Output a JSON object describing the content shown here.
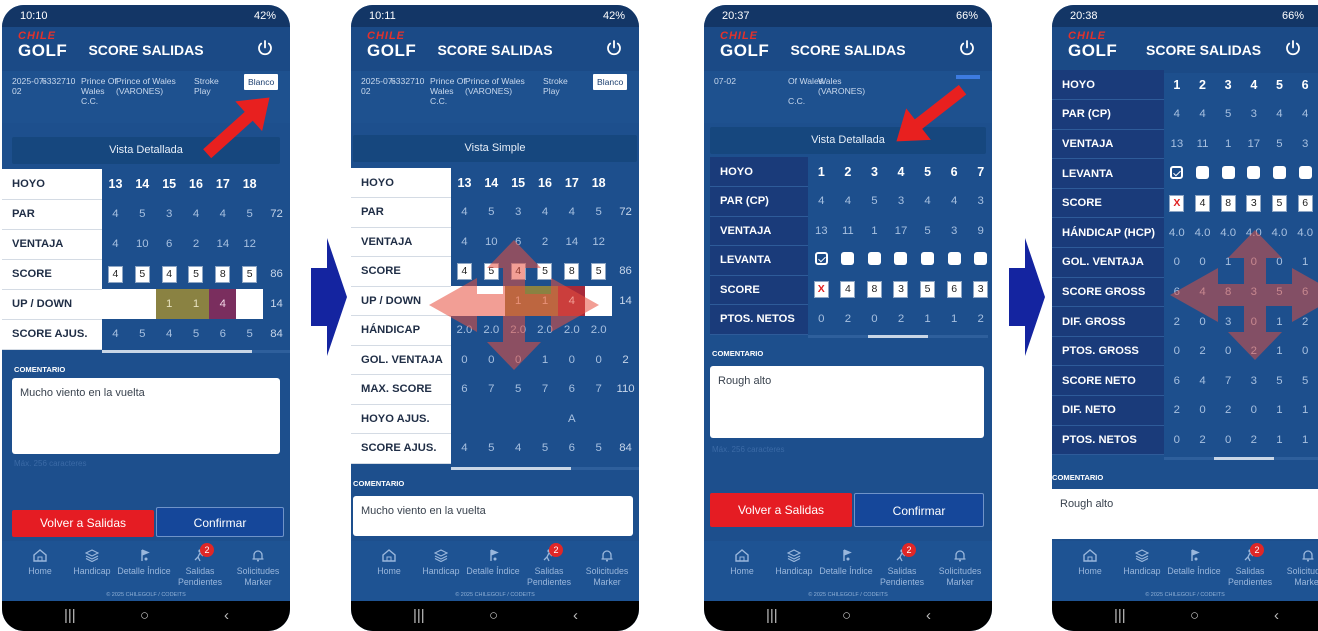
{
  "screens": [
    {
      "status": {
        "time": "10:10",
        "battery": "42%"
      },
      "title": "SCORE SALIDAS",
      "logo": {
        "line1": "CHILE",
        "line2": "GOLF"
      },
      "info": {
        "date": "2025-07-02",
        "id": "6332710",
        "club": "Prince Of Wales C.C.",
        "tee_course": "Prince of Wales (VARONES)",
        "mode": "Stroke Play",
        "tee": "Blanco"
      },
      "vista_button": "Vista Detallada",
      "rows": [
        {
          "label": "HOYO",
          "cells": [
            "13",
            "14",
            "15",
            "16",
            "17",
            "18"
          ],
          "total": ""
        },
        {
          "label": "PAR",
          "cells": [
            "4",
            "5",
            "3",
            "4",
            "4",
            "5"
          ],
          "total": "72"
        },
        {
          "label": "VENTAJA",
          "cells": [
            "4",
            "10",
            "6",
            "2",
            "14",
            "12"
          ],
          "total": ""
        },
        {
          "label": "SCORE",
          "cells": [
            "4",
            "5",
            "4",
            "5",
            "8",
            "5"
          ],
          "total": "86"
        },
        {
          "label": "UP / DOWN",
          "cells": [
            "",
            "",
            "1",
            "1",
            "4",
            ""
          ],
          "total": "14"
        },
        {
          "label": "SCORE AJUS.",
          "cells": [
            "4",
            "5",
            "4",
            "5",
            "6",
            "5"
          ],
          "total": "84"
        }
      ],
      "comment_label": "COMENTARIO",
      "comment": "Mucho viento en la vuelta",
      "max_chars": "Máx. 256 caracteres",
      "btn_back": "Volver a Salidas",
      "btn_confirm": "Confirmar"
    },
    {
      "status": {
        "time": "10:11",
        "battery": "42%"
      },
      "title": "SCORE SALIDAS",
      "logo": {
        "line1": "CHILE",
        "line2": "GOLF"
      },
      "info": {
        "date": "2025-07-02",
        "id": "6332710",
        "club": "Prince Of Wales C.C.",
        "tee_course": "Prince of Wales (VARONES)",
        "mode": "Stroke Play",
        "tee": "Blanco"
      },
      "vista_button": "Vista Simple",
      "rows": [
        {
          "label": "HOYO",
          "cells": [
            "13",
            "14",
            "15",
            "16",
            "17",
            "18"
          ],
          "total": ""
        },
        {
          "label": "PAR",
          "cells": [
            "4",
            "5",
            "3",
            "4",
            "4",
            "5"
          ],
          "total": "72"
        },
        {
          "label": "VENTAJA",
          "cells": [
            "4",
            "10",
            "6",
            "2",
            "14",
            "12"
          ],
          "total": ""
        },
        {
          "label": "SCORE",
          "cells": [
            "4",
            "5",
            "4",
            "5",
            "8",
            "5"
          ],
          "total": "86"
        },
        {
          "label": "UP / DOWN",
          "cells": [
            "",
            "",
            "1",
            "1",
            "4",
            ""
          ],
          "total": "14"
        },
        {
          "label": "HÁNDICAP",
          "cells": [
            "2.0",
            "2.0",
            "2.0",
            "2.0",
            "2.0",
            "2.0"
          ],
          "total": ""
        },
        {
          "label": "GOL. VENTAJA",
          "cells": [
            "0",
            "0",
            "0",
            "1",
            "0",
            "0"
          ],
          "total": "2"
        },
        {
          "label": "MAX. SCORE",
          "cells": [
            "6",
            "7",
            "5",
            "7",
            "6",
            "7"
          ],
          "total": "110"
        },
        {
          "label": "HOYO AJUS.",
          "cells": [
            "",
            "",
            "",
            "",
            "A",
            ""
          ],
          "total": ""
        },
        {
          "label": "SCORE AJUS.",
          "cells": [
            "4",
            "5",
            "4",
            "5",
            "6",
            "5"
          ],
          "total": "84"
        }
      ],
      "comment_label": "COMENTARIO",
      "comment": "Mucho viento en la vuelta"
    },
    {
      "status": {
        "time": "20:37",
        "battery": "66%"
      },
      "title": "SCORE SALIDAS",
      "logo": {
        "line1": "CHILE",
        "line2": "GOLF"
      },
      "info": {
        "date": "07-02",
        "club": "C.C.",
        "tee_course": "Wales (VARONES)",
        "club_line": "Of Wales"
      },
      "vista_button": "Vista Detallada",
      "rows": [
        {
          "label": "HOYO",
          "cells": [
            "1",
            "2",
            "3",
            "4",
            "5",
            "6",
            "7"
          ]
        },
        {
          "label": "PAR (CP)",
          "cells": [
            "4",
            "4",
            "5",
            "3",
            "4",
            "4",
            "3"
          ]
        },
        {
          "label": "VENTAJA",
          "cells": [
            "13",
            "11",
            "1",
            "17",
            "5",
            "3",
            "9"
          ]
        },
        {
          "label": "LEVANTA",
          "cells": [
            "on",
            "",
            "",
            "",
            "",
            "",
            ""
          ]
        },
        {
          "label": "SCORE",
          "cells": [
            "X",
            "4",
            "8",
            "3",
            "5",
            "6",
            "3"
          ]
        },
        {
          "label": "PTOS. NETOS",
          "cells": [
            "0",
            "2",
            "0",
            "2",
            "1",
            "1",
            "2"
          ]
        }
      ],
      "comment_label": "COMENTARIO",
      "comment": "Rough alto",
      "max_chars": "Máx. 256 caracteres",
      "btn_back": "Volver a Salidas",
      "btn_confirm": "Confirmar"
    },
    {
      "status": {
        "time": "20:38",
        "battery": "66%"
      },
      "title": "SCORE SALIDAS",
      "logo": {
        "line1": "CHILE",
        "line2": "GOLF"
      },
      "rows": [
        {
          "label": "HOYO",
          "cells": [
            "1",
            "2",
            "3",
            "4",
            "5",
            "6"
          ]
        },
        {
          "label": "PAR (CP)",
          "cells": [
            "4",
            "4",
            "5",
            "3",
            "4",
            "4"
          ]
        },
        {
          "label": "VENTAJA",
          "cells": [
            "13",
            "11",
            "1",
            "17",
            "5",
            "3"
          ]
        },
        {
          "label": "LEVANTA",
          "cells": [
            "on",
            "",
            "",
            "",
            "",
            ""
          ]
        },
        {
          "label": "SCORE",
          "cells": [
            "X",
            "4",
            "8",
            "3",
            "5",
            "6"
          ]
        },
        {
          "label": "HÁNDICAP (HCP)",
          "cells": [
            "4.0",
            "4.0",
            "4.0",
            "4.0",
            "4.0",
            "4.0"
          ]
        },
        {
          "label": "GOL. VENTAJA",
          "cells": [
            "0",
            "0",
            "1",
            "0",
            "0",
            "1"
          ]
        },
        {
          "label": "SCORE GROSS",
          "cells": [
            "6",
            "4",
            "8",
            "3",
            "5",
            "6"
          ]
        },
        {
          "label": "DIF. GROSS",
          "cells": [
            "2",
            "0",
            "3",
            "0",
            "1",
            "2"
          ]
        },
        {
          "label": "PTOS. GROSS",
          "cells": [
            "0",
            "2",
            "0",
            "2",
            "1",
            "0"
          ]
        },
        {
          "label": "SCORE NETO",
          "cells": [
            "6",
            "4",
            "7",
            "3",
            "5",
            "5"
          ]
        },
        {
          "label": "DIF. NETO",
          "cells": [
            "2",
            "0",
            "2",
            "0",
            "1",
            "1"
          ]
        },
        {
          "label": "PTOS. NETOS",
          "cells": [
            "0",
            "2",
            "0",
            "2",
            "1",
            "1"
          ]
        }
      ],
      "comment_label": "COMENTARIO",
      "comment": "Rough alto"
    }
  ],
  "nav": [
    {
      "label": "Home",
      "icon": "home-icon"
    },
    {
      "label": "Handicap",
      "icon": "layers-icon"
    },
    {
      "label": "Detalle Índice",
      "icon": "golf-flag-icon"
    },
    {
      "label": "Salidas Pendientes",
      "icon": "golfer-icon",
      "badge": "2"
    },
    {
      "label": "Solicitudes Marker",
      "icon": "bell-icon"
    }
  ],
  "copyright": "© 2025 CHILEGOLF / CODEITS",
  "colors": {
    "primary": "#1d4f8d",
    "header": "#1b4a86",
    "danger": "#e51c23",
    "arrow_red": "#e8201f",
    "flow_arrow": "#1424a0"
  }
}
